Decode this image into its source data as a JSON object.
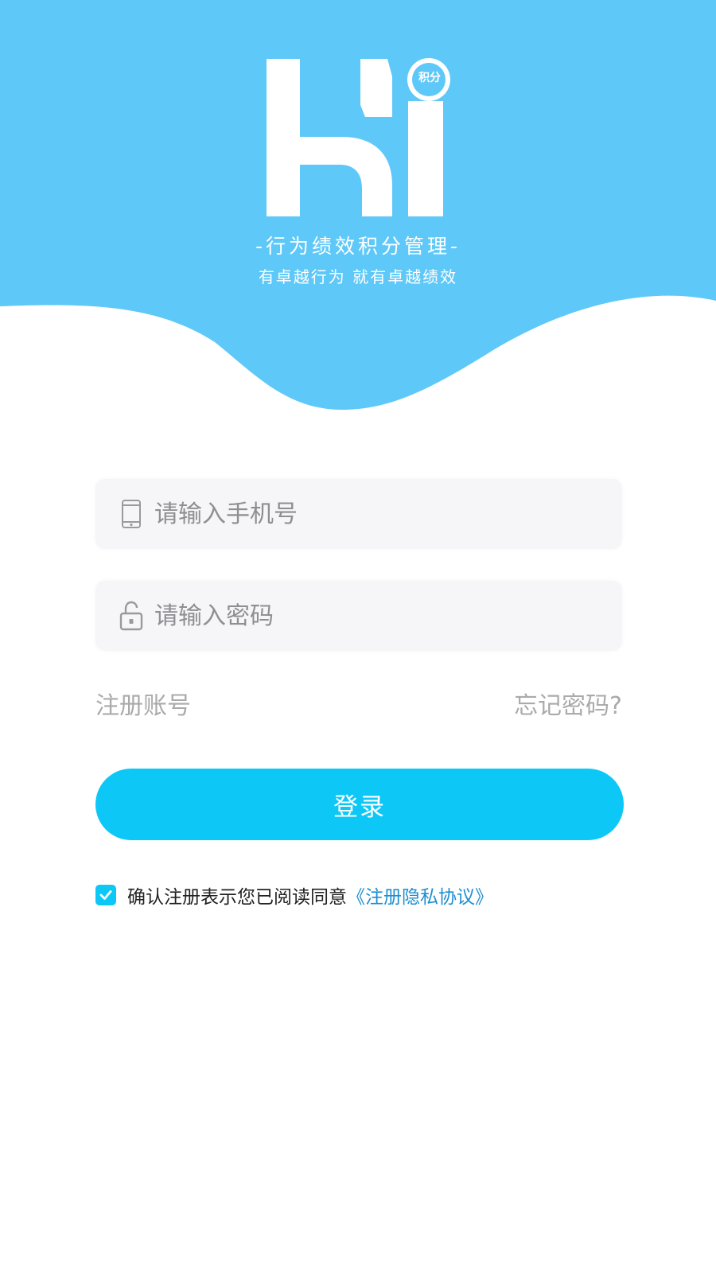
{
  "header": {
    "logo_text": "Hi",
    "logo_badge": "积分",
    "tagline": "-行为绩效积分管理-",
    "slogan": "有卓越行为 就有卓越绩效"
  },
  "form": {
    "phone": {
      "placeholder": "请输入手机号",
      "icon": "phone-icon"
    },
    "password": {
      "placeholder": "请输入密码",
      "icon": "lock-icon"
    }
  },
  "links": {
    "register": "注册账号",
    "forgot": "忘记密码?"
  },
  "login_button": "登录",
  "agreement": {
    "checked": true,
    "text": "确认注册表示您已阅读同意",
    "link": "《注册隐私协议》"
  },
  "colors": {
    "hero": "#5ec8f8",
    "primary": "#0dc8f7",
    "link": "#1e8fd0"
  }
}
